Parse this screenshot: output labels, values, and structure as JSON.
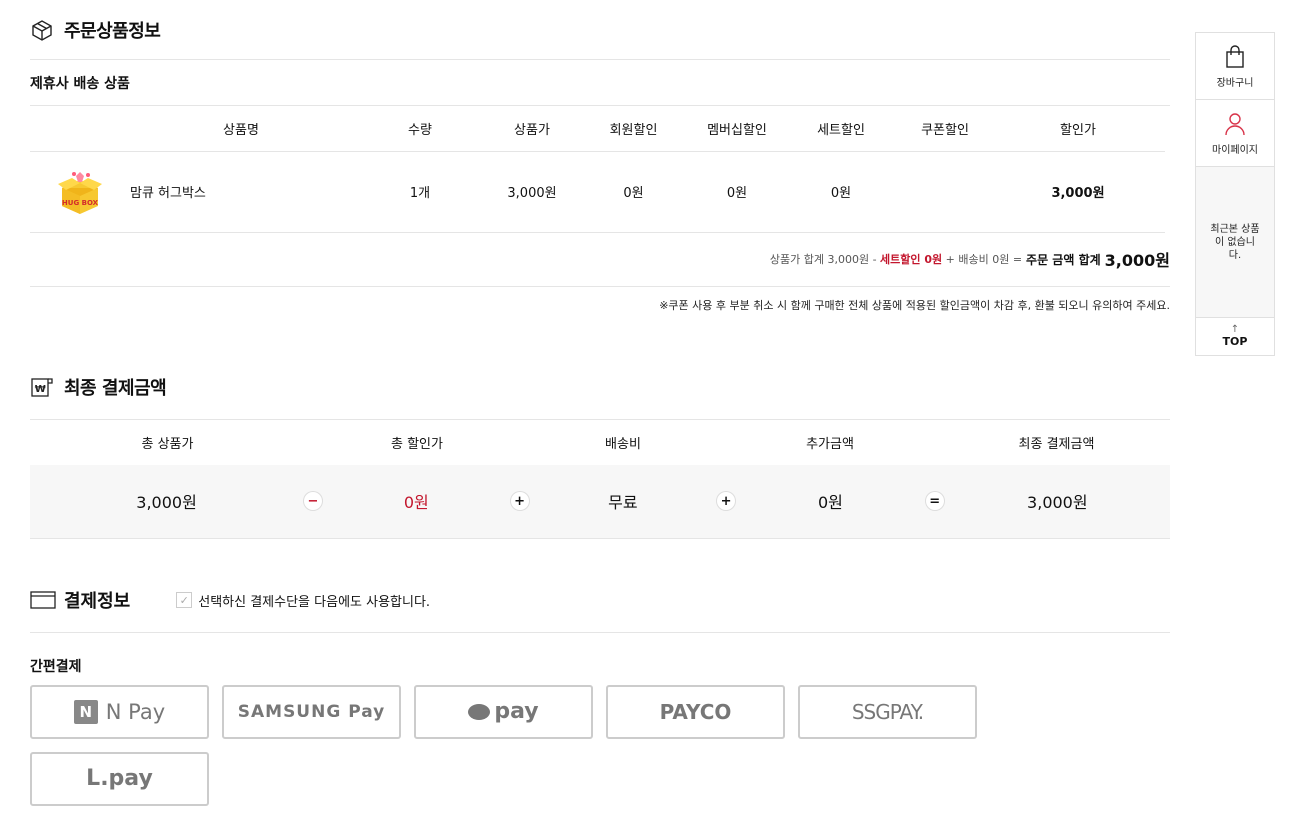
{
  "order": {
    "title": "주문상품정보",
    "group_title": "제휴사 배송 상품",
    "columns": [
      "상품명",
      "수량",
      "상품가",
      "회원할인",
      "멤버십할인",
      "세트할인",
      "쿠폰할인",
      "할인가"
    ],
    "rows": [
      {
        "name": "맘큐 허그박스",
        "qty": "1개",
        "price": "3,000원",
        "member_discount": "0원",
        "membership_discount": "0원",
        "set_discount": "0원",
        "coupon_discount": "",
        "sale_price": "3,000원"
      }
    ],
    "summary": {
      "product_total": "상품가 합계 3,000원 -",
      "set_discount": "세트할인 0원",
      "shipping": "+ 배송비 0원 =",
      "order_total_label": "주문 금액 합계",
      "order_total": "3,000원"
    },
    "notice": "※쿠폰 사용 후 부분 취소 시 함께 구매한 전체 상품에 적용된 할인금액이 차감 후, 환불 되오니 유의하여 주세요."
  },
  "final": {
    "title": "최종 결제금액",
    "headers": [
      "총 상품가",
      "총 할인가",
      "배송비",
      "추가금액",
      "최종 결제금액"
    ],
    "values": [
      "3,000원",
      "0원",
      "무료",
      "0원",
      "3,000원"
    ],
    "ops": [
      "−",
      "+",
      "+",
      "="
    ]
  },
  "payment": {
    "title": "결제정보",
    "reuse_label": "선택하신 결제수단을 다음에도 사용합니다.",
    "easy_title": "간편결제",
    "methods": [
      "N Pay",
      "SAMSUNG Pay",
      "pay",
      "PAYCO",
      "SSGPAY.",
      "L.pay"
    ]
  },
  "quick": {
    "cart": "장바구니",
    "mypage": "마이페이지",
    "recent": "최근본 상품이 없습니다.",
    "top": "TOP"
  },
  "colors": {
    "accent_red": "#c3162d",
    "border": "#e5e5e5",
    "panel_bg": "#f7f7f7"
  }
}
